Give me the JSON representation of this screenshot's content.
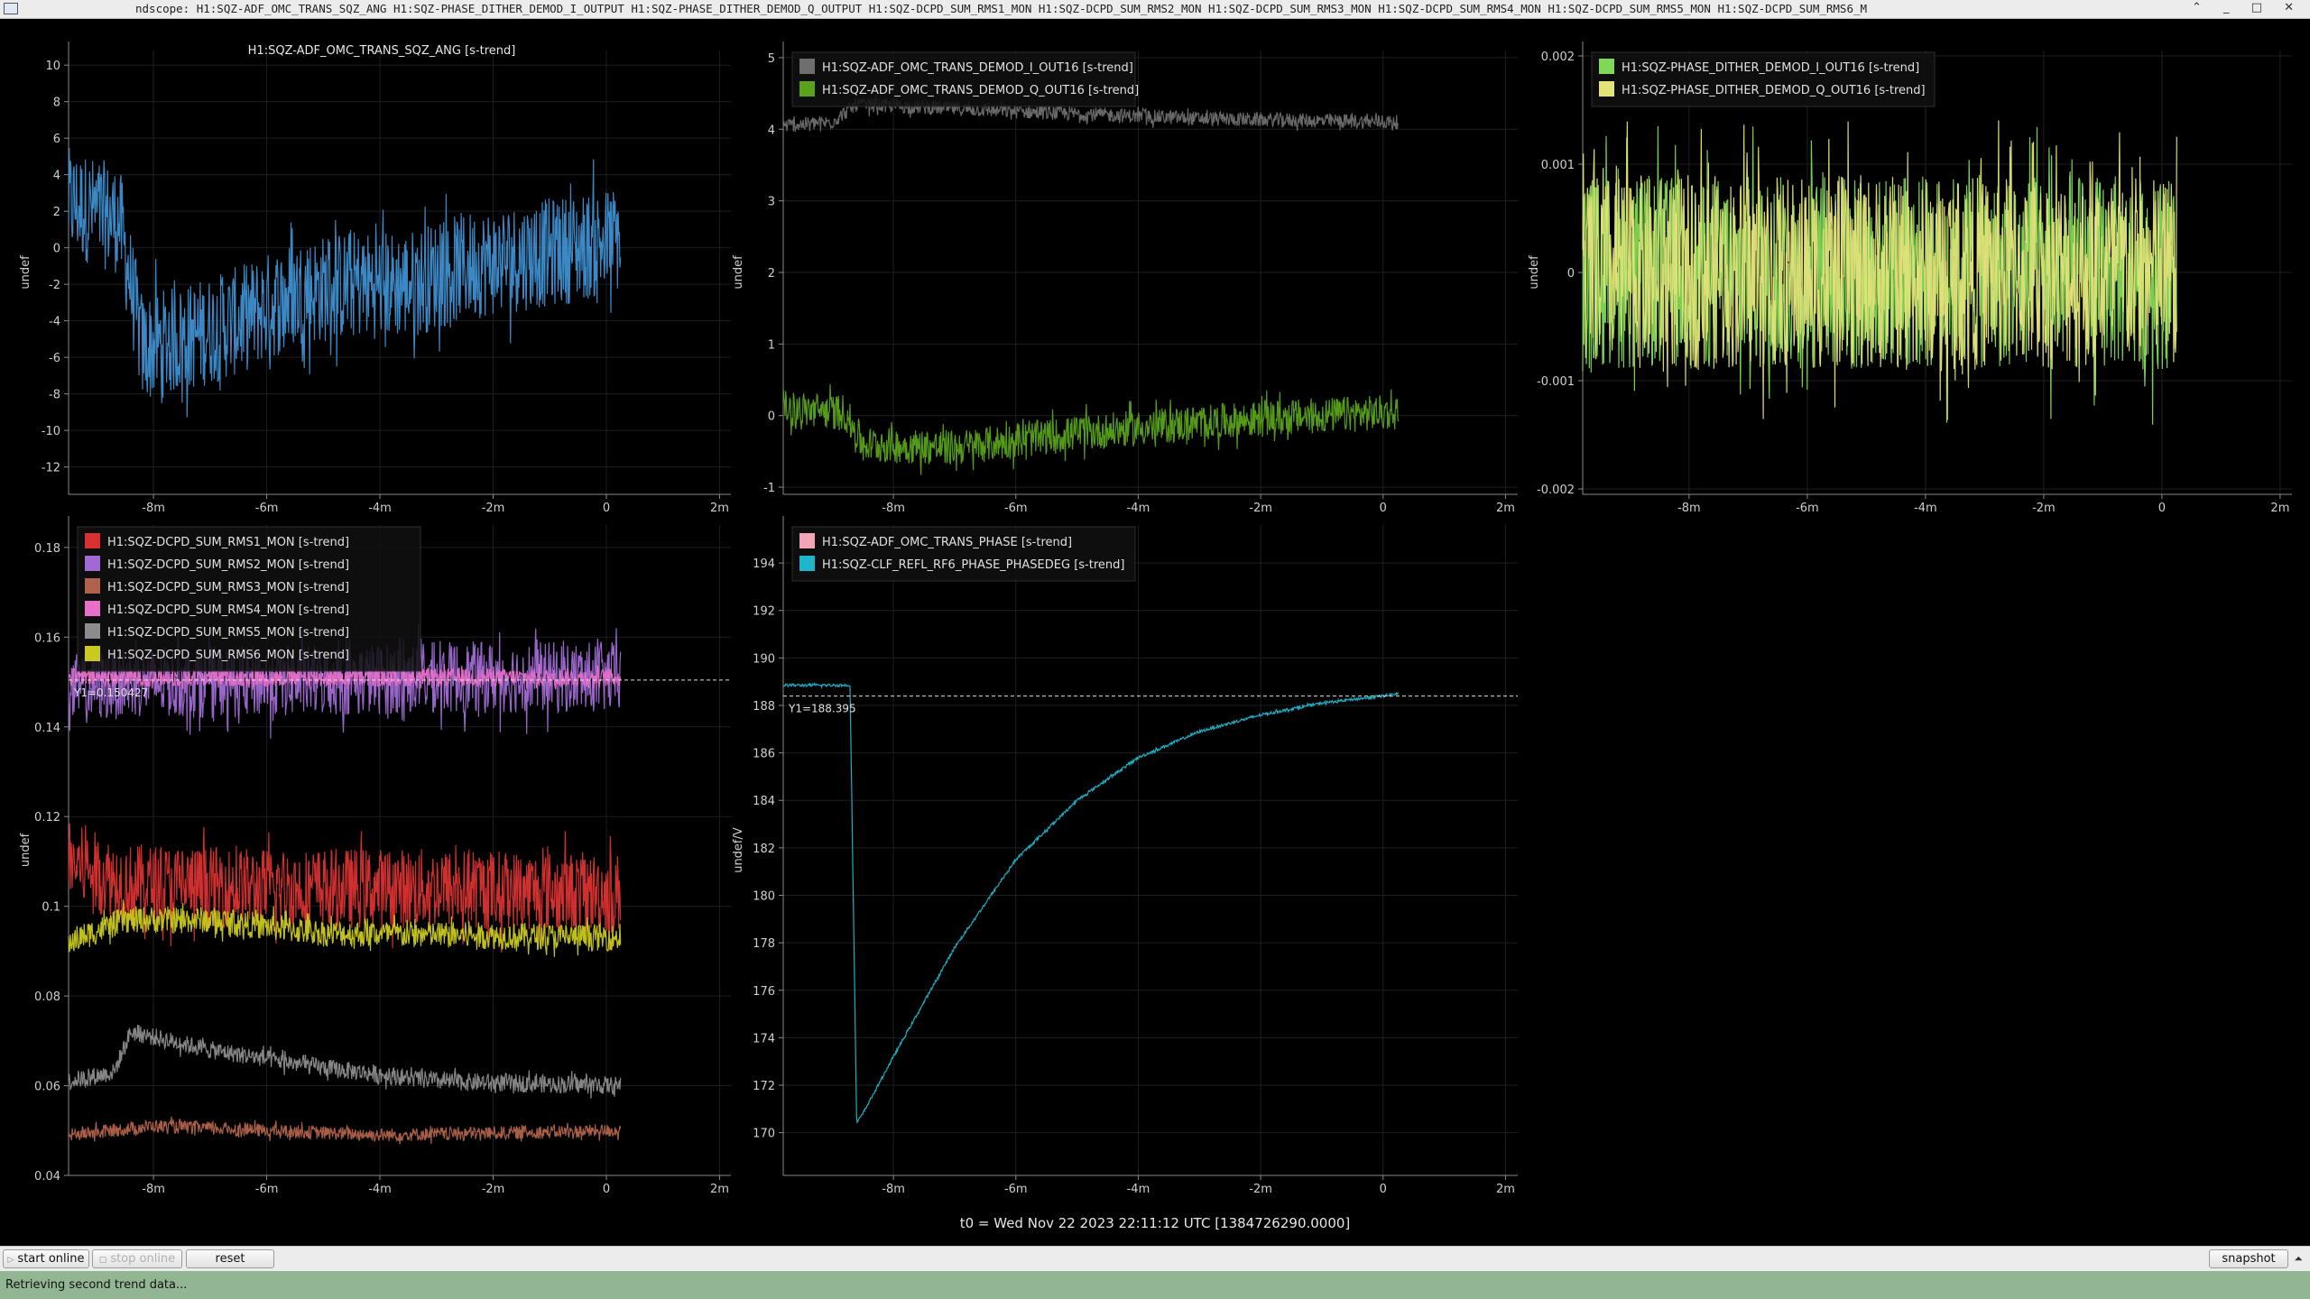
{
  "window": {
    "title": "ndscope: H1:SQZ-ADF_OMC_TRANS_SQZ_ANG H1:SQZ-PHASE_DITHER_DEMOD_I_OUTPUT H1:SQZ-PHASE_DITHER_DEMOD_Q_OUTPUT H1:SQZ-DCPD_SUM_RMS1_MON H1:SQZ-DCPD_SUM_RMS2_MON H1:SQZ-DCPD_SUM_RMS3_MON H1:SQZ-DCPD_SUM_RMS4_MON H1:SQZ-DCPD_SUM_RMS5_MON H1:SQZ-DCPD_SUM_RMS6_M",
    "controls": "⌃ _ □ ✕"
  },
  "t0_label": "t0 = Wed Nov 22 2023 22:11:12 UTC [1384726290.0000]",
  "chart_data": [
    {
      "type": "line",
      "title": "H1:SQZ-ADF_OMC_TRANS_SQZ_ANG [s-trend]",
      "ylabel": "undef",
      "xlim": [
        -9.5,
        2.2
      ],
      "ylim": [
        -13.5,
        10.8
      ],
      "yticks": [
        10,
        8,
        6,
        4,
        2,
        0,
        -2,
        -4,
        -6,
        -8,
        -10,
        -12
      ],
      "xticks": [
        -8,
        -6,
        -4,
        -2,
        0,
        2
      ],
      "xtick_labels": [
        "-8m",
        "-6m",
        "-4m",
        "-2m",
        "0",
        "2m"
      ],
      "grid": true,
      "series": [
        {
          "color": "#3f8fd0",
          "values": [
            {
              "x": -9.5,
              "y": 2.5
            },
            {
              "x": -8.6,
              "y": 1.5
            },
            {
              "x": -8.4,
              "y": -2.0
            },
            {
              "x": -8.2,
              "y": -5.5
            },
            {
              "x": -7.5,
              "y": -5.0
            },
            {
              "x": -6.5,
              "y": -4.0
            },
            {
              "x": -5.5,
              "y": -2.5
            },
            {
              "x": -4.5,
              "y": -2.0
            },
            {
              "x": -3.5,
              "y": -2.0
            },
            {
              "x": -2.5,
              "y": -1.0
            },
            {
              "x": -1.5,
              "y": -0.5
            },
            {
              "x": -0.5,
              "y": 0.0
            },
            {
              "x": 0.25,
              "y": 0.5
            }
          ],
          "amplitude": 3.0
        }
      ]
    },
    {
      "type": "line",
      "title": "",
      "ylabel": "undef",
      "xlim": [
        -9.8,
        2.2
      ],
      "ylim": [
        -1.1,
        5.1
      ],
      "yticks": [
        5,
        4,
        3,
        2,
        1,
        0,
        -1
      ],
      "xticks": [
        -8,
        -6,
        -4,
        -2,
        0,
        2
      ],
      "xtick_labels": [
        "-8m",
        "-6m",
        "-4m",
        "-2m",
        "0",
        "2m"
      ],
      "grid": true,
      "legend": "top-left",
      "series": [
        {
          "name": "H1:SQZ-ADF_OMC_TRANS_DEMOD_I_OUT16 [s-trend]",
          "color": "#6e6e6e",
          "values": [
            {
              "x": -9.8,
              "y": 4.05
            },
            {
              "x": -9.0,
              "y": 4.1
            },
            {
              "x": -8.6,
              "y": 4.35
            },
            {
              "x": -6.0,
              "y": 4.25
            },
            {
              "x": -3.0,
              "y": 4.15
            },
            {
              "x": 0.25,
              "y": 4.1
            }
          ],
          "amplitude": 0.1
        },
        {
          "name": "H1:SQZ-ADF_OMC_TRANS_DEMOD_Q_OUT16 [s-trend]",
          "color": "#5aa11c",
          "values": [
            {
              "x": -9.8,
              "y": 0.1
            },
            {
              "x": -8.8,
              "y": 0.05
            },
            {
              "x": -8.5,
              "y": -0.4
            },
            {
              "x": -7.0,
              "y": -0.45
            },
            {
              "x": -5.0,
              "y": -0.25
            },
            {
              "x": -3.0,
              "y": -0.1
            },
            {
              "x": -1.0,
              "y": 0.0
            },
            {
              "x": 0.25,
              "y": 0.05
            }
          ],
          "amplitude": 0.25
        }
      ]
    },
    {
      "type": "line",
      "title": "",
      "ylabel": "undef",
      "xlim": [
        -9.8,
        2.2
      ],
      "ylim": [
        -0.00205,
        0.00205
      ],
      "yticks": [
        0.002,
        0.001,
        0,
        -0.001,
        -0.002
      ],
      "ytick_labels": [
        "0.002",
        "0.001",
        "0",
        "-0.001",
        "-0.002"
      ],
      "xticks": [
        -8,
        -6,
        -4,
        -2,
        0,
        2
      ],
      "xtick_labels": [
        "-8m",
        "-6m",
        "-4m",
        "-2m",
        "0",
        "2m"
      ],
      "grid": true,
      "legend": "top-left",
      "series": [
        {
          "name": "H1:SQZ-PHASE_DITHER_DEMOD_I_OUT16 [s-trend]",
          "color": "#7fd957",
          "values": [
            {
              "x": -9.8,
              "y": 0.0
            },
            {
              "x": 0.25,
              "y": 0.0
            }
          ],
          "amplitude": 0.0009
        },
        {
          "name": "H1:SQZ-PHASE_DITHER_DEMOD_Q_OUT16 [s-trend]",
          "color": "#e3e37a",
          "values": [
            {
              "x": -9.8,
              "y": 0.0
            },
            {
              "x": 0.25,
              "y": 0.0
            }
          ],
          "amplitude": 0.0009
        }
      ]
    },
    {
      "type": "line",
      "title": "",
      "ylabel": "undef",
      "xlim": [
        -9.5,
        2.2
      ],
      "ylim": [
        0.04,
        0.185
      ],
      "yticks": [
        0.18,
        0.16,
        0.14,
        0.12,
        0.1,
        0.08,
        0.06,
        0.04
      ],
      "ytick_labels": [
        "0.18",
        "0.16",
        "0.14",
        "0.12",
        "0.1",
        "0.08",
        "0.06",
        "0.04"
      ],
      "xticks": [
        -8,
        -6,
        -4,
        -2,
        0,
        2
      ],
      "xtick_labels": [
        "-8m",
        "-6m",
        "-4m",
        "-2m",
        "0",
        "2m"
      ],
      "grid": true,
      "legend": "top-left",
      "cursor": {
        "label": "Y1=0.150427",
        "y": 0.150427
      },
      "series": [
        {
          "name": "H1:SQZ-DCPD_SUM_RMS1_MON [s-trend]",
          "color": "#d93131",
          "values": [
            {
              "x": -9.5,
              "y": 0.11
            },
            {
              "x": -8.5,
              "y": 0.105
            },
            {
              "x": -6.0,
              "y": 0.104
            },
            {
              "x": -3.0,
              "y": 0.104
            },
            {
              "x": 0.25,
              "y": 0.103
            }
          ],
          "amplitude": 0.009
        },
        {
          "name": "H1:SQZ-DCPD_SUM_RMS2_MON [s-trend]",
          "color": "#a06ad4",
          "values": [
            {
              "x": -9.5,
              "y": 0.148
            },
            {
              "x": -8.5,
              "y": 0.15
            },
            {
              "x": -6.0,
              "y": 0.15
            },
            {
              "x": -3.0,
              "y": 0.151
            },
            {
              "x": 0.25,
              "y": 0.151
            }
          ],
          "amplitude": 0.008
        },
        {
          "name": "H1:SQZ-DCPD_SUM_RMS3_MON [s-trend]",
          "color": "#b0624a",
          "values": [
            {
              "x": -9.5,
              "y": 0.049
            },
            {
              "x": -8.0,
              "y": 0.051
            },
            {
              "x": -4.0,
              "y": 0.049
            },
            {
              "x": 0.25,
              "y": 0.05
            }
          ],
          "amplitude": 0.0015
        },
        {
          "name": "H1:SQZ-DCPD_SUM_RMS4_MON [s-trend]",
          "color": "#e86fc8",
          "values": [
            {
              "x": -9.5,
              "y": 0.151
            },
            {
              "x": 0.25,
              "y": 0.151
            }
          ],
          "amplitude": 0.002
        },
        {
          "name": "H1:SQZ-DCPD_SUM_RMS5_MON [s-trend]",
          "color": "#8c8c8c",
          "values": [
            {
              "x": -9.5,
              "y": 0.061
            },
            {
              "x": -8.7,
              "y": 0.063
            },
            {
              "x": -8.4,
              "y": 0.072
            },
            {
              "x": -7.0,
              "y": 0.068
            },
            {
              "x": -5.0,
              "y": 0.064
            },
            {
              "x": -3.0,
              "y": 0.061
            },
            {
              "x": 0.25,
              "y": 0.06
            }
          ],
          "amplitude": 0.002
        },
        {
          "name": "H1:SQZ-DCPD_SUM_RMS6_MON [s-trend]",
          "color": "#c9c920",
          "values": [
            {
              "x": -9.5,
              "y": 0.092
            },
            {
              "x": -8.5,
              "y": 0.097
            },
            {
              "x": -7.0,
              "y": 0.097
            },
            {
              "x": -5.0,
              "y": 0.094
            },
            {
              "x": 0.25,
              "y": 0.093
            }
          ],
          "amplitude": 0.003
        }
      ]
    },
    {
      "type": "line",
      "title": "",
      "ylabel": "undef/V",
      "xlim": [
        -9.8,
        2.2
      ],
      "ylim": [
        168.2,
        195.6
      ],
      "yticks": [
        194,
        192,
        190,
        188,
        186,
        184,
        182,
        180,
        178,
        176,
        174,
        172,
        170
      ],
      "xticks": [
        -8,
        -6,
        -4,
        -2,
        0,
        2
      ],
      "xtick_labels": [
        "-8m",
        "-6m",
        "-4m",
        "-2m",
        "0",
        "2m"
      ],
      "grid": true,
      "legend": "top-left",
      "cursor": {
        "label": "Y1=188.395",
        "y": 188.395
      },
      "series": [
        {
          "name": "H1:SQZ-ADF_OMC_TRANS_PHASE [s-trend]",
          "color": "#f2a5b6",
          "values": []
        },
        {
          "name": "H1:SQZ-CLF_REFL_RF6_PHASE_PHASEDEG [s-trend]",
          "color": "#1db6cc",
          "values": [
            {
              "x": -9.8,
              "y": 188.85
            },
            {
              "x": -8.7,
              "y": 188.85
            },
            {
              "x": -8.7,
              "y": 187.5
            },
            {
              "x": -8.6,
              "y": 170.4
            },
            {
              "x": -8.5,
              "y": 170.8
            },
            {
              "x": -8.0,
              "y": 173.2
            },
            {
              "x": -7.0,
              "y": 177.8
            },
            {
              "x": -6.0,
              "y": 181.5
            },
            {
              "x": -5.0,
              "y": 184.0
            },
            {
              "x": -4.0,
              "y": 185.8
            },
            {
              "x": -3.0,
              "y": 186.9
            },
            {
              "x": -2.0,
              "y": 187.6
            },
            {
              "x": -1.0,
              "y": 188.1
            },
            {
              "x": 0.0,
              "y": 188.4
            },
            {
              "x": 0.25,
              "y": 188.5
            }
          ],
          "amplitude": 0.06
        }
      ]
    }
  ],
  "toolbar": {
    "start_online": "start online",
    "stop_online": "stop online",
    "reset": "reset",
    "snapshot": "snapshot",
    "collapse_icon": "arrow-up-icon"
  },
  "status": "Retrieving second trend data..."
}
